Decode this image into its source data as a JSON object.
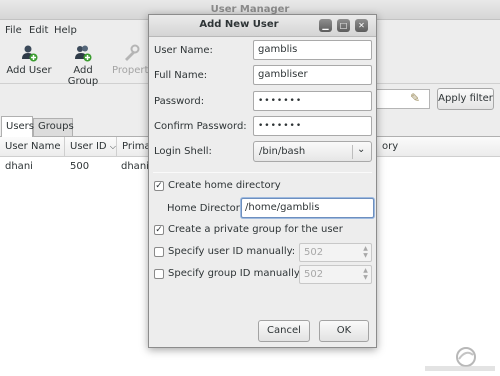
{
  "main": {
    "title": "User Manager",
    "menu": [
      "File",
      "Edit",
      "Help"
    ],
    "toolbar": {
      "add_user": "Add User",
      "add_group": "Add Group",
      "properties": "Properties"
    },
    "apply_filter": "Apply filter",
    "tabs": [
      "Users",
      "Groups"
    ],
    "columns": [
      "User Name",
      "User ID",
      "Primary",
      "ory"
    ],
    "rows": [
      {
        "user_name": "dhani",
        "user_id": "500",
        "primary": "dhani"
      }
    ]
  },
  "dialog": {
    "title": "Add New User",
    "fields": {
      "user_name": {
        "label": "User Name:",
        "value": "gamblis"
      },
      "full_name": {
        "label": "Full Name:",
        "value": "gambliser"
      },
      "password": {
        "label": "Password:",
        "value": "•••••••"
      },
      "confirm_password": {
        "label": "Confirm Password:",
        "value": "•••••••"
      },
      "login_shell": {
        "label": "Login Shell:",
        "value": "/bin/bash"
      }
    },
    "create_home": {
      "label": "Create home directory",
      "checked": true
    },
    "home_directory": {
      "label": "Home Directory:",
      "value": "/home/gamblis"
    },
    "private_group": {
      "label": "Create a private group for the user",
      "checked": true
    },
    "specify_uid": {
      "label": "Specify user ID manually:",
      "checked": false,
      "value": "502"
    },
    "specify_gid": {
      "label": "Specify group ID manually:",
      "checked": false,
      "value": "502"
    },
    "buttons": {
      "cancel": "Cancel",
      "ok": "OK"
    }
  },
  "icons": {
    "add_user": "add-user-icon",
    "add_group": "add-group-icon",
    "properties": "properties-icon",
    "filter_clear": "clear-icon"
  },
  "colors": {
    "accent": "#6d8fbf",
    "add_badge": "#3a9c2f"
  }
}
